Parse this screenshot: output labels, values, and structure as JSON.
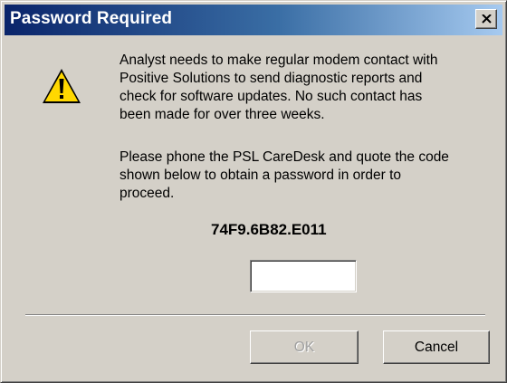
{
  "window": {
    "title": "Password Required",
    "close_icon": "close-x-icon"
  },
  "icon": "warning-icon",
  "message": {
    "paragraph1": "Analyst needs to make regular modem contact with\nPositive Solutions to send diagnostic reports and\ncheck for software updates. No such contact has\nbeen made for over three weeks.",
    "paragraph2": "Please phone the PSL CareDesk and quote the code\nshown below to obtain a password in order to\nproceed."
  },
  "code": "74F9.6B82.E011",
  "password_input": {
    "value": ""
  },
  "buttons": {
    "ok_label": "OK",
    "cancel_label": "Cancel"
  },
  "colors": {
    "titlebar_start": "#0a246a",
    "titlebar_end": "#a6caf0",
    "dialog_face": "#d4d0c8",
    "warning_yellow": "#ffd800"
  }
}
